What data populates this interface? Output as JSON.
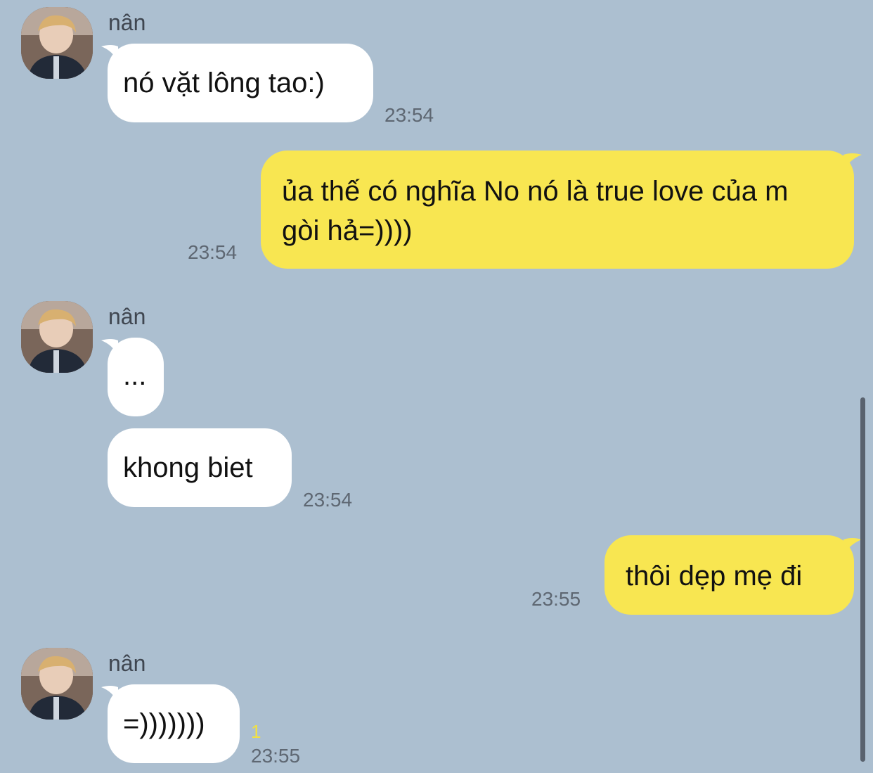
{
  "chat": {
    "colors": {
      "background": "#acbfd0",
      "incoming_bubble": "#ffffff",
      "outgoing_bubble": "#f8e651",
      "timestamp": "#5e6772",
      "unread_count": "#f3e13e"
    },
    "messages": [
      {
        "sender": "nân",
        "text": "nó vặt lông tao:)",
        "time": "23:54"
      },
      {
        "sender": "me",
        "text": "ủa thế có nghĩa No nó là true love của m gòi hả=))))",
        "time": "23:54"
      },
      {
        "sender": "nân",
        "text": "...",
        "time": ""
      },
      {
        "sender": "nân",
        "text": "khong biet",
        "time": "23:54"
      },
      {
        "sender": "me",
        "text": "thôi dẹp mẹ đi",
        "time": "23:55"
      },
      {
        "sender": "nân",
        "text": "=)))))))",
        "time": "23:55",
        "unread": "1"
      }
    ]
  },
  "avatar_icon": "profile-photo-avatar"
}
